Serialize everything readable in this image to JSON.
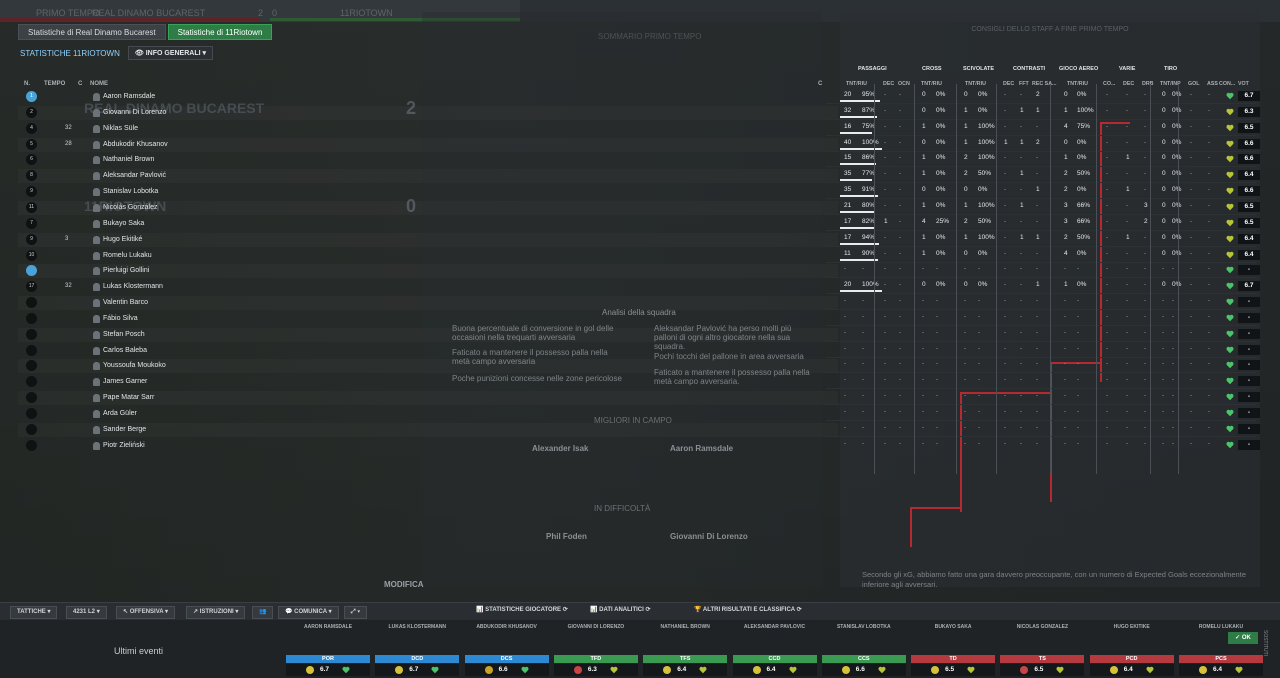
{
  "tabs": [
    "Statistiche di Real Dinamo Bucarest",
    "Statistiche di 11Riotown"
  ],
  "active_tab": 1,
  "left_title": "STATISTICHE 11RIOTOWN",
  "info_button": "INFO GENERALI",
  "table_headers": {
    "n": "N.",
    "tempo": "TEMPO",
    "c": "C",
    "nome": "NOME",
    "c2": "C"
  },
  "stat_groups": [
    "PASSAGGI",
    "CROSS",
    "SCIVOLATE",
    "CONTRASTI",
    "GIOCO AEREO",
    "VARIE",
    "TIRO"
  ],
  "stat_subheads": [
    "TNT/RIU",
    "DEC",
    "OCN",
    "TNT/RIU",
    "TNT/RIU",
    "DEC",
    "FFT",
    "REC SA...",
    "TNT/RIU",
    "CO...",
    "DEC",
    "DRB",
    "TNT/INP",
    "GOL",
    "ASS",
    "CON...",
    "VOT"
  ],
  "players": [
    {
      "num": "1",
      "gk": true,
      "tempo": "",
      "name": "Aaron Ramsdale",
      "pass": "20",
      "pass_pct": "95%",
      "dec": "-",
      "ocn": "-",
      "cross": "0",
      "cross_pct": "0%",
      "sciv": "0",
      "sciv_pct": "0%",
      "dec2": "-",
      "fft": "-",
      "rec": "2",
      "aer": "0",
      "aer_pct": "0%",
      "co": "-",
      "dec3": "-",
      "drb": "-",
      "tiro": "0",
      "tiro_pct": "0%",
      "gol": "-",
      "ass": "-",
      "vot": "6.7"
    },
    {
      "num": "2",
      "gk": false,
      "tempo": "",
      "name": "Giovanni Di Lorenzo",
      "pass": "32",
      "pass_pct": "87%",
      "dec": "-",
      "ocn": "-",
      "cross": "0",
      "cross_pct": "0%",
      "sciv": "1",
      "sciv_pct": "0%",
      "dec2": "-",
      "fft": "1",
      "rec": "1",
      "aer": "1",
      "aer_pct": "100%",
      "co": "-",
      "dec3": "-",
      "drb": "-",
      "tiro": "0",
      "tiro_pct": "0%",
      "gol": "-",
      "ass": "-",
      "vot": "6.3"
    },
    {
      "num": "4",
      "gk": false,
      "tempo": "32",
      "name": "Niklas Süle",
      "pass": "16",
      "pass_pct": "75%",
      "dec": "-",
      "ocn": "-",
      "cross": "1",
      "cross_pct": "0%",
      "sciv": "1",
      "sciv_pct": "100%",
      "dec2": "-",
      "fft": "-",
      "rec": "-",
      "aer": "4",
      "aer_pct": "75%",
      "co": "-",
      "dec3": "-",
      "drb": "-",
      "tiro": "0",
      "tiro_pct": "0%",
      "gol": "-",
      "ass": "-",
      "vot": "6.5"
    },
    {
      "num": "5",
      "gk": false,
      "tempo": "28",
      "name": "Abdukodir Khusanov",
      "pass": "40",
      "pass_pct": "100%",
      "dec": "-",
      "ocn": "-",
      "cross": "0",
      "cross_pct": "0%",
      "sciv": "1",
      "sciv_pct": "100%",
      "dec2": "1",
      "fft": "1",
      "rec": "2",
      "aer": "0",
      "aer_pct": "0%",
      "co": "-",
      "dec3": "-",
      "drb": "-",
      "tiro": "0",
      "tiro_pct": "0%",
      "gol": "-",
      "ass": "-",
      "vot": "6.6"
    },
    {
      "num": "6",
      "gk": false,
      "tempo": "",
      "name": "Nathaniel Brown",
      "pass": "15",
      "pass_pct": "86%",
      "dec": "-",
      "ocn": "-",
      "cross": "1",
      "cross_pct": "0%",
      "sciv": "2",
      "sciv_pct": "100%",
      "dec2": "-",
      "fft": "-",
      "rec": "-",
      "aer": "1",
      "aer_pct": "0%",
      "co": "-",
      "dec3": "1",
      "drb": "-",
      "tiro": "0",
      "tiro_pct": "0%",
      "gol": "-",
      "ass": "-",
      "vot": "6.6"
    },
    {
      "num": "8",
      "gk": false,
      "tempo": "",
      "name": "Aleksandar Pavlović",
      "pass": "35",
      "pass_pct": "77%",
      "dec": "-",
      "ocn": "-",
      "cross": "1",
      "cross_pct": "0%",
      "sciv": "2",
      "sciv_pct": "50%",
      "dec2": "-",
      "fft": "1",
      "rec": "-",
      "aer": "2",
      "aer_pct": "50%",
      "co": "-",
      "dec3": "-",
      "drb": "-",
      "tiro": "0",
      "tiro_pct": "0%",
      "gol": "-",
      "ass": "-",
      "vot": "6.4"
    },
    {
      "num": "9",
      "gk": false,
      "tempo": "",
      "name": "Stanislav Lobotka",
      "pass": "35",
      "pass_pct": "91%",
      "dec": "-",
      "ocn": "-",
      "cross": "0",
      "cross_pct": "0%",
      "sciv": "0",
      "sciv_pct": "0%",
      "dec2": "-",
      "fft": "-",
      "rec": "1",
      "aer": "2",
      "aer_pct": "0%",
      "co": "-",
      "dec3": "1",
      "drb": "-",
      "tiro": "0",
      "tiro_pct": "0%",
      "gol": "-",
      "ass": "-",
      "vot": "6.6"
    },
    {
      "num": "11",
      "gk": false,
      "tempo": "",
      "name": "Nicolás González",
      "pass": "21",
      "pass_pct": "80%",
      "dec": "-",
      "ocn": "-",
      "cross": "1",
      "cross_pct": "0%",
      "sciv": "1",
      "sciv_pct": "100%",
      "dec2": "-",
      "fft": "1",
      "rec": "-",
      "aer": "3",
      "aer_pct": "66%",
      "co": "-",
      "dec3": "-",
      "drb": "3",
      "tiro": "0",
      "tiro_pct": "0%",
      "gol": "-",
      "ass": "-",
      "vot": "6.5"
    },
    {
      "num": "7",
      "gk": false,
      "tempo": "",
      "name": "Bukayo Saka",
      "pass": "17",
      "pass_pct": "82%",
      "dec": "1",
      "ocn": "-",
      "cross": "4",
      "cross_pct": "25%",
      "sciv": "2",
      "sciv_pct": "50%",
      "dec2": "-",
      "fft": "-",
      "rec": "-",
      "aer": "3",
      "aer_pct": "66%",
      "co": "-",
      "dec3": "-",
      "drb": "2",
      "tiro": "0",
      "tiro_pct": "0%",
      "gol": "-",
      "ass": "-",
      "vot": "6.5"
    },
    {
      "num": "9",
      "gk": false,
      "tempo": "3",
      "name": "Hugo Ekitiké",
      "pass": "17",
      "pass_pct": "94%",
      "dec": "-",
      "ocn": "-",
      "cross": "1",
      "cross_pct": "0%",
      "sciv": "1",
      "sciv_pct": "100%",
      "dec2": "-",
      "fft": "1",
      "rec": "1",
      "aer": "2",
      "aer_pct": "50%",
      "co": "-",
      "dec3": "1",
      "drb": "-",
      "tiro": "0",
      "tiro_pct": "0%",
      "gol": "-",
      "ass": "-",
      "vot": "6.4"
    },
    {
      "num": "10",
      "gk": false,
      "tempo": "",
      "name": "Romelu Lukaku",
      "pass": "11",
      "pass_pct": "90%",
      "dec": "-",
      "ocn": "-",
      "cross": "1",
      "cross_pct": "0%",
      "sciv": "0",
      "sciv_pct": "0%",
      "dec2": "-",
      "fft": "-",
      "rec": "-",
      "aer": "4",
      "aer_pct": "0%",
      "co": "-",
      "dec3": "-",
      "drb": "-",
      "tiro": "0",
      "tiro_pct": "0%",
      "gol": "-",
      "ass": "-",
      "vot": "6.4"
    },
    {
      "num": "",
      "gk": true,
      "tempo": "",
      "name": "Pierluigi Gollini",
      "vot": "-"
    },
    {
      "num": "17",
      "gk": false,
      "tempo": "32",
      "name": "Lukas Klostermann",
      "pass": "20",
      "pass_pct": "100%",
      "dec": "-",
      "ocn": "-",
      "cross": "0",
      "cross_pct": "0%",
      "sciv": "0",
      "sciv_pct": "0%",
      "dec2": "-",
      "fft": "-",
      "rec": "1",
      "aer": "1",
      "aer_pct": "0%",
      "co": "-",
      "dec3": "-",
      "drb": "-",
      "tiro": "0",
      "tiro_pct": "0%",
      "gol": "-",
      "ass": "-",
      "vot": "6.7"
    },
    {
      "num": "",
      "gk": false,
      "tempo": "",
      "name": "Valentin Barco",
      "vot": "-"
    },
    {
      "num": "",
      "gk": false,
      "tempo": "",
      "name": "Fábio Silva",
      "vot": "-"
    },
    {
      "num": "",
      "gk": false,
      "tempo": "",
      "name": "Stefan Posch",
      "vot": "-"
    },
    {
      "num": "",
      "gk": false,
      "tempo": "",
      "name": "Carlos Baleba",
      "vot": "-"
    },
    {
      "num": "",
      "gk": false,
      "tempo": "",
      "name": "Youssoufa Moukoko",
      "vot": "-"
    },
    {
      "num": "",
      "gk": false,
      "tempo": "",
      "name": "James Garner",
      "vot": "-"
    },
    {
      "num": "",
      "gk": false,
      "tempo": "",
      "name": "Pape Matar Sarr",
      "vot": "-"
    },
    {
      "num": "",
      "gk": false,
      "tempo": "",
      "name": "Arda Güler",
      "vot": "-"
    },
    {
      "num": "",
      "gk": false,
      "tempo": "",
      "name": "Sander Berge",
      "vot": "-"
    },
    {
      "num": "",
      "gk": false,
      "tempo": "",
      "name": "Piotr Zieliński",
      "vot": "-"
    }
  ],
  "toolbar": {
    "tattiche": "TATTICHE",
    "formation": "4231 L2",
    "offensiva": "OFFENSIVA",
    "istruzioni": "ISTRUZIONI",
    "comunica": "COMUNICA",
    "stat_giocatore": "STATISTICHE GIOCATORE",
    "dati_analitici": "DATI ANALITICI",
    "altri_risultati": "ALTRI RISULTATI E CLASSIFICA"
  },
  "ultimi_eventi": "Ultimi eventi",
  "ok_label": "OK",
  "sostituti": "SOSTITUTI",
  "lineup": [
    {
      "name": "AARON RAMSDALE",
      "pos": "POR",
      "val": "6.7",
      "col": "#2d8ad2"
    },
    {
      "name": "LUKAS KLOSTERMANN",
      "pos": "DCD",
      "val": "6.7",
      "col": "#2d8ad2"
    },
    {
      "name": "ABDUKODIR KHUSANOV",
      "pos": "DCS",
      "val": "6.6",
      "col": "#2d8ad2"
    },
    {
      "name": "GIOVANNI DI LORENZO",
      "pos": "TFD",
      "val": "6.3",
      "col": "#3b9a52"
    },
    {
      "name": "NATHANIEL BROWN",
      "pos": "TFS",
      "val": "6.4",
      "col": "#3b9a52"
    },
    {
      "name": "ALEKSANDAR PAVLOVIĆ",
      "pos": "CCD",
      "val": "6.4",
      "col": "#3b9a52"
    },
    {
      "name": "STANISLAV LOBOTKA",
      "pos": "CCS",
      "val": "6.6",
      "col": "#3b9a52"
    },
    {
      "name": "BUKAYO SAKA",
      "pos": "TD",
      "val": "6.5",
      "col": "#b53a3f"
    },
    {
      "name": "NICOLÁS GONZÁLEZ",
      "pos": "TS",
      "val": "6.5",
      "col": "#b53a3f"
    },
    {
      "name": "HUGO EKITIKÉ",
      "pos": "PCD",
      "val": "6.4",
      "col": "#b53a3f"
    },
    {
      "name": "ROMELU LUKAKU",
      "pos": "PCS",
      "val": "6.4",
      "col": "#b53a3f"
    }
  ],
  "right_panel": {
    "title": "CONSIGLI DELLO STAFF A FINE PRIMO TEMPO",
    "footer": "Secondo gli xG, abbiamo fatto una gara davvero preoccupante, con un numero di Expected Goals eccezionalmente inferiore agli avversari."
  },
  "ghost": {
    "match_label": "PRIMO TEMPO",
    "home": "REAL DINAMO BUCAREST",
    "away": "11RIOTOWN",
    "score_home": "2",
    "score_away": "0",
    "center_title": "SOMMARIO PRIMO TEMPO",
    "analisi": "Analisi della squadra",
    "migliori": "MIGLIORI IN CAMPO",
    "in_difficolta": "IN DIFFICOLTÀ",
    "note1": "Buona percentuale di conversione in gol delle occasioni nella trequarti avversaria",
    "note2": "Faticato a mantenere il possesso palla nella metà campo avversaria",
    "note3": "Poche punizioni concesse nelle zone pericolose",
    "note4": "Aleksandar Pavlović ha perso molti più palloni di ogni altro giocatore nella sua squadra.",
    "note5": "Pochi tocchi del pallone in area avversaria",
    "note6": "Faticato a mantenere il possesso palla nella metà campo avversaria.",
    "best1": "Alexander Isak",
    "best2": "Aaron Ramsdale",
    "worst1": "Phil Foden",
    "worst2": "Giovanni Di Lorenzo",
    "modifica": "MODIFICA"
  }
}
